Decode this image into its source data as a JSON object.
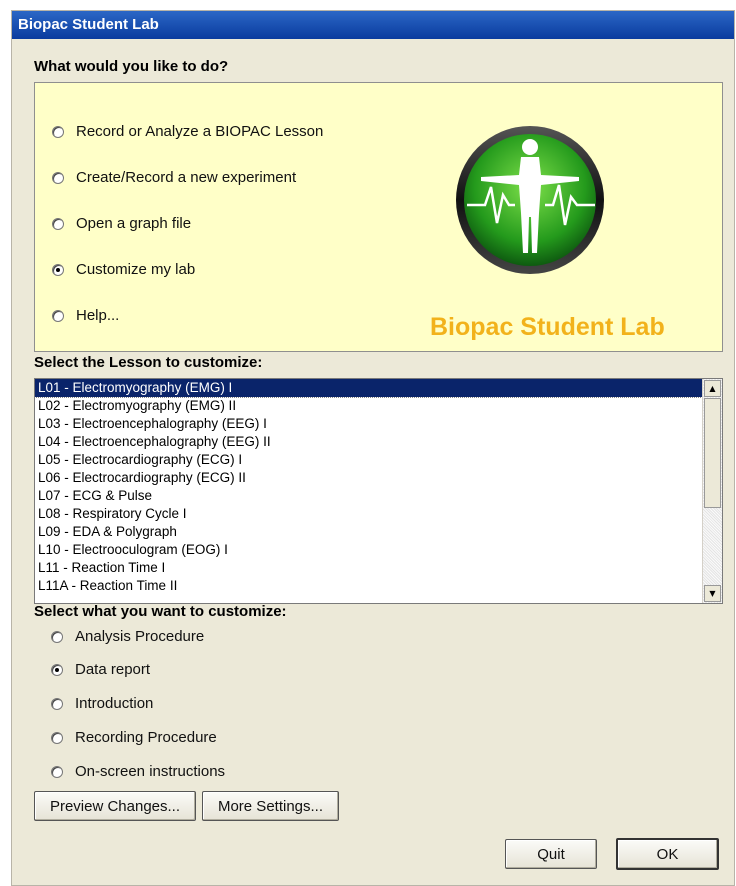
{
  "window": {
    "title": "Biopac Student Lab"
  },
  "main": {
    "prompt": "What would you like to do?",
    "options": [
      {
        "label": "Record or Analyze a BIOPAC Lesson",
        "checked": false
      },
      {
        "label": "Create/Record a new experiment",
        "checked": false
      },
      {
        "label": "Open a graph file",
        "checked": false
      },
      {
        "label": "Customize my lab",
        "checked": true
      },
      {
        "label": "Help...",
        "checked": false
      }
    ],
    "logo_text": "Biopac Student Lab"
  },
  "lessons": {
    "heading": "Select the Lesson to customize:",
    "items": [
      "L01 - Electromyography (EMG) I",
      "L02 - Electromyography (EMG) II",
      "L03 - Electroencephalography (EEG) I",
      "L04 - Electroencephalography (EEG) II",
      "L05 - Electrocardiography (ECG) I",
      "L06 - Electrocardiography (ECG) II",
      "L07 - ECG & Pulse",
      "L08 - Respiratory Cycle I",
      "L09 - EDA & Polygraph",
      "L10 - Electrooculogram (EOG) I",
      "L11 - Reaction Time I",
      "L11A - Reaction Time II"
    ],
    "selected_index": 0
  },
  "customize": {
    "heading": "Select what you want to customize:",
    "options": [
      {
        "label": "Analysis Procedure",
        "checked": false
      },
      {
        "label": "Data report",
        "checked": true
      },
      {
        "label": "Introduction",
        "checked": false
      },
      {
        "label": "Recording Procedure",
        "checked": false
      },
      {
        "label": "On-screen instructions",
        "checked": false
      }
    ]
  },
  "buttons": {
    "preview": "Preview Changes...",
    "more_settings": "More Settings...",
    "quit": "Quit",
    "ok": "OK"
  },
  "colors": {
    "panel_bg": "#ffffc8",
    "logo_text": "#f2b21b",
    "title_bar": "#0a3b9e",
    "selection": "#0a246a"
  }
}
